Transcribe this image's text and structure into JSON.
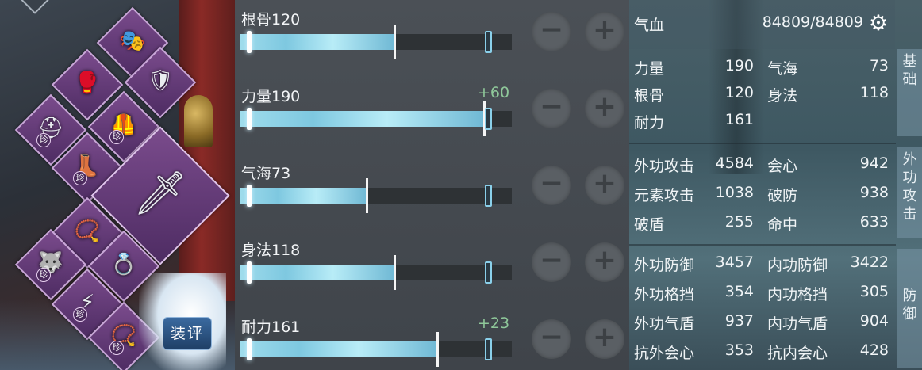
{
  "equipment": {
    "rating_button": "装评",
    "rare_badge": "珍",
    "slots": [
      {
        "icon": "mask-icon",
        "glyph": "🎭"
      },
      {
        "icon": "gauntlet-icon",
        "glyph": "🥊"
      },
      {
        "icon": "bracer-icon",
        "glyph": "🛡"
      },
      {
        "icon": "helmet-icon",
        "glyph": "⛑",
        "rare": true
      },
      {
        "icon": "armor-icon",
        "glyph": "🦺",
        "rare": true
      },
      {
        "icon": "boots-icon",
        "glyph": "👢",
        "rare": true
      },
      {
        "icon": "weapon-icon",
        "glyph": "🗡"
      },
      {
        "icon": "necklace-icon",
        "glyph": "📿"
      },
      {
        "icon": "ring-icon",
        "glyph": "💍"
      },
      {
        "icon": "beast-pendant-icon",
        "glyph": "🐺",
        "rare": true
      },
      {
        "icon": "lightning-charm-icon",
        "glyph": "⚡",
        "rare": true
      },
      {
        "icon": "bead-bracelet-icon",
        "glyph": "📿",
        "rare": true
      }
    ]
  },
  "attributes": [
    {
      "label": "根骨120",
      "bonus": "",
      "fill": 0.57,
      "marker": 0.9
    },
    {
      "label": "力量190",
      "bonus": "+60",
      "fill": 0.9,
      "marker": 0.9
    },
    {
      "label": "气海73",
      "bonus": "",
      "fill": 0.47,
      "marker": 0.9
    },
    {
      "label": "身法118",
      "bonus": "",
      "fill": 0.57,
      "marker": 0.9
    },
    {
      "label": "耐力161",
      "bonus": "+23",
      "fill": 0.73,
      "marker": 0.9
    }
  ],
  "buttons": {
    "minus": "−",
    "plus": "+"
  },
  "stats": {
    "hp_label": "气血",
    "hp_value": "84809/84809",
    "basic": [
      [
        "力量",
        "190",
        "气海",
        "73"
      ],
      [
        "根骨",
        "120",
        "身法",
        "118"
      ],
      [
        "耐力",
        "161",
        "",
        ""
      ]
    ],
    "attack": [
      [
        "外功攻击",
        "4584",
        "会心",
        "942"
      ],
      [
        "元素攻击",
        "1038",
        "破防",
        "938"
      ],
      [
        "破盾",
        "255",
        "命中",
        "633"
      ]
    ],
    "defense": [
      [
        "外功防御",
        "3457",
        "内功防御",
        "3422"
      ],
      [
        "外功格挡",
        "354",
        "内功格挡",
        "305"
      ],
      [
        "外功气盾",
        "937",
        "内功气盾",
        "904"
      ],
      [
        "抗外会心",
        "353",
        "抗内会心",
        "428"
      ]
    ],
    "tabs": {
      "basic": [
        "基",
        "础"
      ],
      "attack": [
        "外",
        "功",
        "攻",
        "击"
      ],
      "defense": [
        "防",
        "御"
      ]
    }
  }
}
